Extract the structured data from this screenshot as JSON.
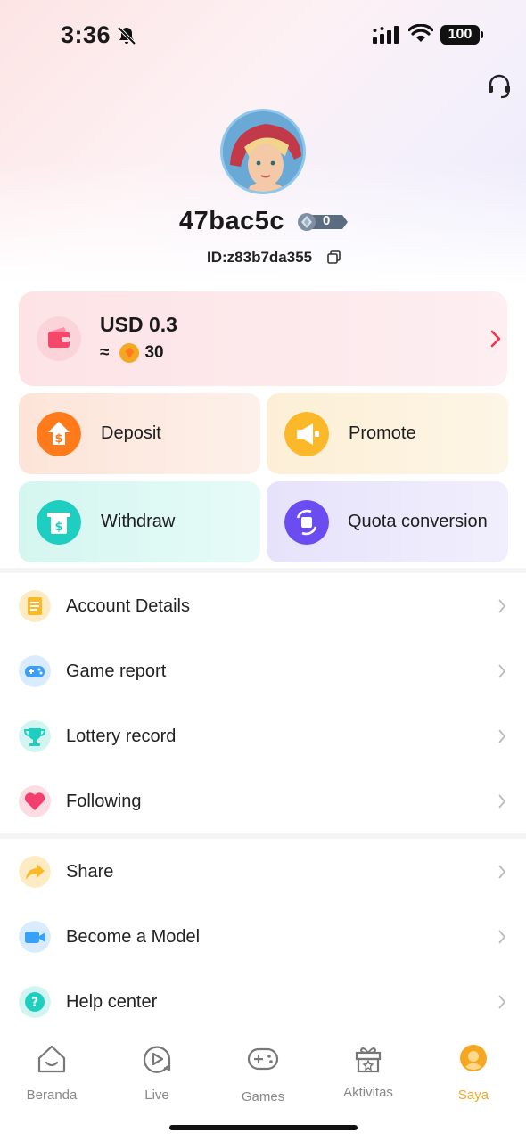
{
  "status_bar": {
    "time": "3:36",
    "battery": "100"
  },
  "profile": {
    "username": "47bac5c",
    "level": "0",
    "user_id": "ID:z83b7da355"
  },
  "balance": {
    "main": "USD 0.3",
    "approx_symbol": "≈",
    "coins": "30"
  },
  "actions": [
    {
      "label": "Deposit",
      "icon": "dollar-upload-icon",
      "color": "#ff7a1a"
    },
    {
      "label": "Promote",
      "icon": "megaphone-icon",
      "color": "#fbb829"
    },
    {
      "label": "Withdraw",
      "icon": "atm-withdraw-icon",
      "color": "#1ecfc1"
    },
    {
      "label": "Quota conversion",
      "icon": "convert-icon",
      "color": "#6a4cf0"
    }
  ],
  "menu_group_1": [
    {
      "label": "Account Details",
      "icon": "receipt-icon",
      "color": "#fbb829"
    },
    {
      "label": "Game report",
      "icon": "gamepad-icon",
      "color": "#3aa0f5"
    },
    {
      "label": "Lottery record",
      "icon": "trophy-icon",
      "color": "#1ecfc1"
    },
    {
      "label": "Following",
      "icon": "heart-icon",
      "color": "#f43f6e"
    }
  ],
  "menu_group_2": [
    {
      "label": "Share",
      "icon": "share-arrow-icon",
      "color": "#fbb829"
    },
    {
      "label": "Become a Model",
      "icon": "video-camera-icon",
      "color": "#3aa0f5"
    },
    {
      "label": "Help center",
      "icon": "question-icon",
      "color": "#1ecfc1"
    }
  ],
  "tabs": [
    {
      "label": "Beranda",
      "icon": "home-icon",
      "active": false
    },
    {
      "label": "Live",
      "icon": "live-play-icon",
      "active": false
    },
    {
      "label": "Games",
      "icon": "gamepad-icon",
      "active": false
    },
    {
      "label": "Aktivitas",
      "icon": "gift-icon",
      "active": false
    },
    {
      "label": "Saya",
      "icon": "profile-icon",
      "active": true
    }
  ],
  "colors": {
    "accent": "#f5a623",
    "chevron_red": "#f0364d"
  }
}
